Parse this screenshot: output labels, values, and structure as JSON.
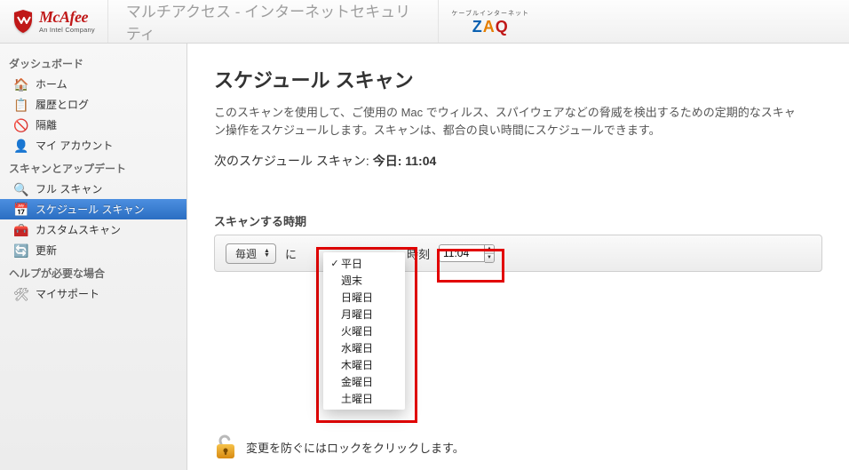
{
  "header": {
    "logo_brand": "McAfee",
    "logo_sub": "An Intel Company",
    "title": "マルチアクセス - インターネットセキュリティ",
    "partner_caption": "ケーブルインターネット",
    "partner_brand_z": "Z",
    "partner_brand_a": "A",
    "partner_brand_q": "Q"
  },
  "sidebar": {
    "group1": "ダッシュボード",
    "items1": {
      "home": "ホーム",
      "history": "履歴とログ",
      "quarantine": "隔離",
      "account": "マイ アカウント"
    },
    "group2": "スキャンとアップデート",
    "items2": {
      "full": "フル スキャン",
      "schedule": "スケジュール スキャン",
      "custom": "カスタムスキャン",
      "update": "更新"
    },
    "group3": "ヘルプが必要な場合",
    "items3": {
      "support": "マイサポート"
    }
  },
  "main": {
    "title": "スケジュール スキャン",
    "desc": "このスキャンを使用して、ご使用の Mac でウィルス、スパイウェアなどの脅威を検出するための定期的なスキャン操作をスケジュールします。スキャンは、都合の良い時間にスケジュールできます。",
    "next_label": "次のスケジュール スキャン: ",
    "next_value": "今日: 11:04",
    "section_label": "スキャンする時期",
    "freq_value": "毎週",
    "conj": "に",
    "time_label": "時刻",
    "time_value": "11:04",
    "day_options": [
      "平日",
      "週末",
      "日曜日",
      "月曜日",
      "火曜日",
      "水曜日",
      "木曜日",
      "金曜日",
      "土曜日"
    ],
    "day_selected_index": 0,
    "lock_text": "変更を防ぐにはロックをクリックします。"
  }
}
